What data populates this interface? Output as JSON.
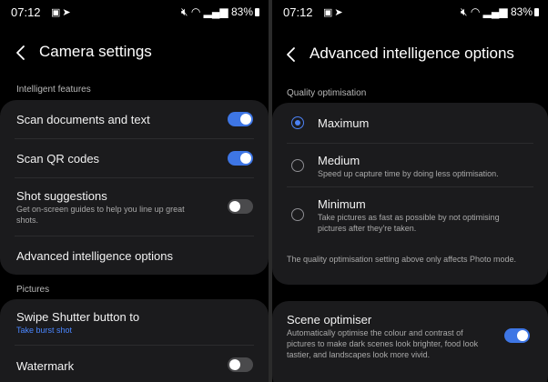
{
  "status": {
    "time": "07:12",
    "battery": "83%",
    "notification_icons": [
      "image-icon",
      "telegram-icon"
    ],
    "system_icons": [
      "mute-icon",
      "wifi-icon",
      "signal-icon",
      "battery-icon"
    ]
  },
  "left": {
    "title": "Camera settings",
    "sections": {
      "intelligent": "Intelligent features",
      "pictures": "Pictures"
    },
    "items": {
      "scan_documents": {
        "label": "Scan documents and text",
        "on": true
      },
      "scan_qr": {
        "label": "Scan QR codes",
        "on": true
      },
      "shot_suggestions": {
        "label": "Shot suggestions",
        "desc": "Get on-screen guides to help you line up great shots.",
        "on": false
      },
      "advanced": {
        "label": "Advanced intelligence options"
      },
      "swipe_shutter": {
        "label": "Swipe Shutter button to",
        "value": "Take burst shot"
      },
      "watermark": {
        "label": "Watermark",
        "on": false
      }
    }
  },
  "right": {
    "title": "Advanced intelligence options",
    "section": "Quality optimisation",
    "options": [
      {
        "label": "Maximum",
        "desc": "",
        "selected": true
      },
      {
        "label": "Medium",
        "desc": "Speed up capture time by doing less optimisation.",
        "selected": false
      },
      {
        "label": "Minimum",
        "desc": "Take pictures as fast as possible by not optimising pictures after they're taken.",
        "selected": false
      }
    ],
    "note": "The quality optimisation setting above only affects Photo mode.",
    "scene": {
      "label": "Scene optimiser",
      "desc": "Automatically optimise the colour and contrast of pictures to make dark scenes look brighter, food look tastier, and landscapes look more vivid.",
      "on": true
    }
  },
  "colors": {
    "accent": "#3e76e5",
    "card": "#1b1b1d",
    "link": "#4a86ff"
  }
}
